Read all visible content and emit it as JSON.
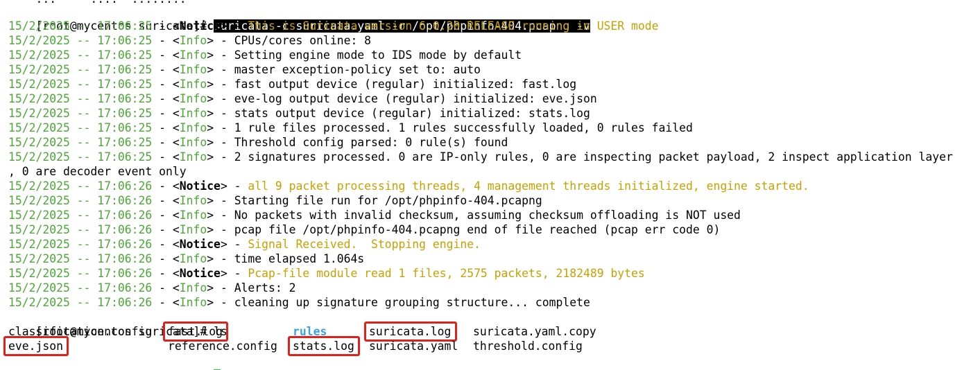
{
  "terminal": {
    "partial_top_line": "    ...     ....  ........",
    "prompt": "[root@mycentos suricata]# ",
    "command": "suricata -c suricata.yaml -r /opt/phpinfo-404.pcapng -v",
    "log_sep": " - ",
    "lines": [
      {
        "ts": "15/2/2025 -- 17:06:25",
        "level": "Notice",
        "msg": "This is Suricata version 6.0.20 RELEASE running in USER mode"
      },
      {
        "ts": "15/2/2025 -- 17:06:25",
        "level": "Info",
        "msg": "CPUs/cores online: 8"
      },
      {
        "ts": "15/2/2025 -- 17:06:25",
        "level": "Info",
        "msg": "Setting engine mode to IDS mode by default"
      },
      {
        "ts": "15/2/2025 -- 17:06:25",
        "level": "Info",
        "msg": "master exception-policy set to: auto"
      },
      {
        "ts": "15/2/2025 -- 17:06:25",
        "level": "Info",
        "msg": "fast output device (regular) initialized: fast.log"
      },
      {
        "ts": "15/2/2025 -- 17:06:25",
        "level": "Info",
        "msg": "eve-log output device (regular) initialized: eve.json"
      },
      {
        "ts": "15/2/2025 -- 17:06:25",
        "level": "Info",
        "msg": "stats output device (regular) initialized: stats.log"
      },
      {
        "ts": "15/2/2025 -- 17:06:25",
        "level": "Info",
        "msg": "1 rule files processed. 1 rules successfully loaded, 0 rules failed"
      },
      {
        "ts": "15/2/2025 -- 17:06:25",
        "level": "Info",
        "msg": "Threshold config parsed: 0 rule(s) found"
      },
      {
        "ts": "15/2/2025 -- 17:06:25",
        "level": "Info",
        "msg": "2 signatures processed. 0 are IP-only rules, 0 are inspecting packet payload, 2 inspect application layer"
      },
      {
        "continuation": ", 0 are decoder event only"
      },
      {
        "ts": "15/2/2025 -- 17:06:26",
        "level": "Notice",
        "msg": "all 9 packet processing threads, 4 management threads initialized, engine started."
      },
      {
        "ts": "15/2/2025 -- 17:06:26",
        "level": "Info",
        "msg": "Starting file run for /opt/phpinfo-404.pcapng"
      },
      {
        "ts": "15/2/2025 -- 17:06:26",
        "level": "Info",
        "msg": "No packets with invalid checksum, assuming checksum offloading is NOT used"
      },
      {
        "ts": "15/2/2025 -- 17:06:26",
        "level": "Info",
        "msg": "pcap file /opt/phpinfo-404.pcapng end of file reached (pcap err code 0)"
      },
      {
        "ts": "15/2/2025 -- 17:06:26",
        "level": "Notice",
        "msg": "Signal Received.  Stopping engine."
      },
      {
        "ts": "15/2/2025 -- 17:06:26",
        "level": "Info",
        "msg": "time elapsed 1.064s"
      },
      {
        "ts": "15/2/2025 -- 17:06:26",
        "level": "Notice",
        "msg": "Pcap-file module read 1 files, 2575 packets, 2182489 bytes"
      },
      {
        "ts": "15/2/2025 -- 17:06:26",
        "level": "Info",
        "msg": "Alerts: 2"
      },
      {
        "ts": "15/2/2025 -- 17:06:26",
        "level": "Info",
        "msg": "cleaning up signature grouping structure... complete"
      }
    ],
    "ls_command": "ls",
    "ls_rows": [
      [
        {
          "name": "classification.config",
          "type": "file",
          "highlight": false
        },
        {
          "name": "fast.log",
          "type": "file",
          "highlight": true
        },
        {
          "name": "rules",
          "type": "dir",
          "highlight": false
        },
        {
          "name": "suricata.log",
          "type": "file",
          "highlight": true
        },
        {
          "name": "suricata.yaml.copy",
          "type": "file",
          "highlight": false
        }
      ],
      [
        {
          "name": "eve.json",
          "type": "file",
          "highlight": true
        },
        {
          "name": "reference.config",
          "type": "file",
          "highlight": false
        },
        {
          "name": "stats.log",
          "type": "file",
          "highlight": true
        },
        {
          "name": "suricata.yaml",
          "type": "file",
          "highlight": false
        },
        {
          "name": "threshold.config",
          "type": "file",
          "highlight": false
        }
      ]
    ],
    "colors": {
      "timestamp": "#4aa834",
      "notice_message": "#c8a000",
      "directory": "#3aa3e3",
      "highlight_box": "#e0201b",
      "cursor": "#2ecc40"
    }
  }
}
